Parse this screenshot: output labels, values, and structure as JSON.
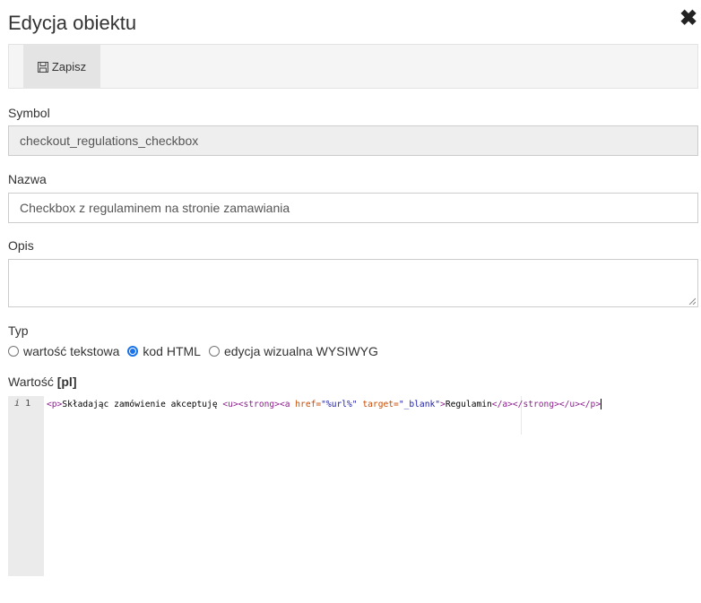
{
  "dialog": {
    "title": "Edycja obiektu",
    "close_icon": "close-icon"
  },
  "toolbar": {
    "save_label": "Zapisz",
    "save_icon": "floppy-disk-icon"
  },
  "fields": {
    "symbol": {
      "label": "Symbol",
      "value": "checkout_regulations_checkbox"
    },
    "nazwa": {
      "label": "Nazwa",
      "value": "Checkbox z regulaminem na stronie zamawiania"
    },
    "opis": {
      "label": "Opis",
      "value": ""
    }
  },
  "typ": {
    "label": "Typ",
    "options": [
      {
        "label": "wartość tekstowa",
        "checked": false
      },
      {
        "label": "kod HTML",
        "checked": true
      },
      {
        "label": "edycja wizualna WYSIWYG",
        "checked": false
      }
    ]
  },
  "value_editor": {
    "label": "Wartość",
    "lang": "[pl]",
    "line_number": "1",
    "line_marker": "i",
    "code": {
      "p_open": "<p>",
      "text": "Składając zamówienie akceptuję ",
      "u_open": "<u>",
      "strong_open": "<strong>",
      "a_open_start": "<a ",
      "attr_href": "href=",
      "href_val": "\"%url%\"",
      "attr_target": " target=",
      "target_val": "\"_blank\"",
      "a_open_end": ">",
      "link_text": "Regulamin",
      "closing": "</a></strong></u></p>"
    }
  },
  "colors": {
    "radio_accent": "#1a73e8",
    "toolbar_bg": "#f5f5f5",
    "readonly_bg": "#eeeeee"
  }
}
